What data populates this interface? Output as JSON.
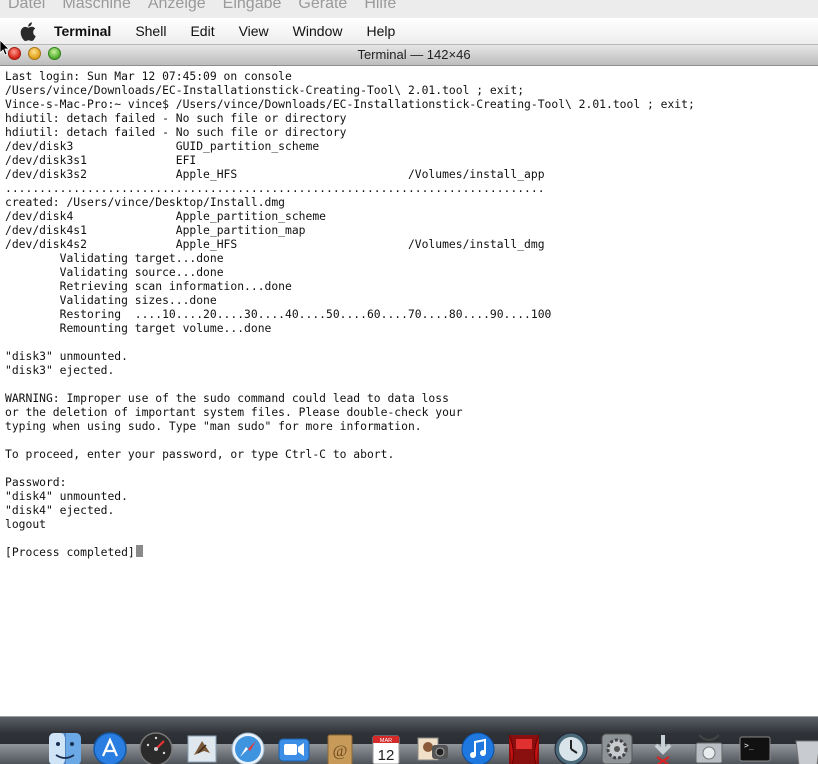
{
  "host_menu": {
    "items": [
      "Datei",
      "Maschine",
      "Anzeige",
      "Eingabe",
      "Geräte",
      "Hilfe"
    ]
  },
  "menubar": {
    "app_name": "Terminal",
    "items": [
      "Shell",
      "Edit",
      "View",
      "Window",
      "Help"
    ]
  },
  "window": {
    "title": "Terminal — 142×46"
  },
  "terminal": {
    "lines": [
      "Last login: Sun Mar 12 07:45:09 on console",
      "/Users/vince/Downloads/EC-Installationstick-Creating-Tool\\ 2.01.tool ; exit;",
      "Vince-s-Mac-Pro:~ vince$ /Users/vince/Downloads/EC-Installationstick-Creating-Tool\\ 2.01.tool ; exit;",
      "hdiutil: detach failed - No such file or directory",
      "hdiutil: detach failed - No such file or directory",
      "/dev/disk3               GUID_partition_scheme",
      "/dev/disk3s1             EFI",
      "/dev/disk3s2             Apple_HFS                         /Volumes/install_app",
      "...............................................................................",
      "created: /Users/vince/Desktop/Install.dmg",
      "/dev/disk4               Apple_partition_scheme",
      "/dev/disk4s1             Apple_partition_map",
      "/dev/disk4s2             Apple_HFS                         /Volumes/install_dmg",
      "        Validating target...done",
      "        Validating source...done",
      "        Retrieving scan information...done",
      "        Validating sizes...done",
      "        Restoring  ....10....20....30....40....50....60....70....80....90....100",
      "        Remounting target volume...done",
      "",
      "\"disk3\" unmounted.",
      "\"disk3\" ejected.",
      "",
      "WARNING: Improper use of the sudo command could lead to data loss",
      "or the deletion of important system files. Please double-check your",
      "typing when using sudo. Type \"man sudo\" for more information.",
      "",
      "To proceed, enter your password, or type Ctrl-C to abort.",
      "",
      "Password:",
      "\"disk4\" unmounted.",
      "\"disk4\" ejected.",
      "logout",
      "",
      "[Process completed]"
    ]
  },
  "dock": {
    "icons": [
      "finder-icon",
      "app-store-icon",
      "dashboard-icon",
      "mail-icon",
      "safari-icon",
      "facetime-icon",
      "address-book-icon",
      "ical-icon",
      "photo-booth-icon",
      "itunes-icon",
      "front-row-icon",
      "time-machine-icon",
      "system-preferences-icon",
      "downloads-stack-icon",
      "disk-utility-icon",
      "terminal-icon",
      "trash-icon"
    ],
    "ical_day": "12",
    "ical_month": "MAR"
  },
  "colors": {
    "menubar_bg": "#ececec",
    "terminal_bg": "#ffffff",
    "terminal_fg": "#111111",
    "close_red": "#d8281c",
    "minimize_yellow": "#e1a21e",
    "zoom_green": "#55b032"
  }
}
